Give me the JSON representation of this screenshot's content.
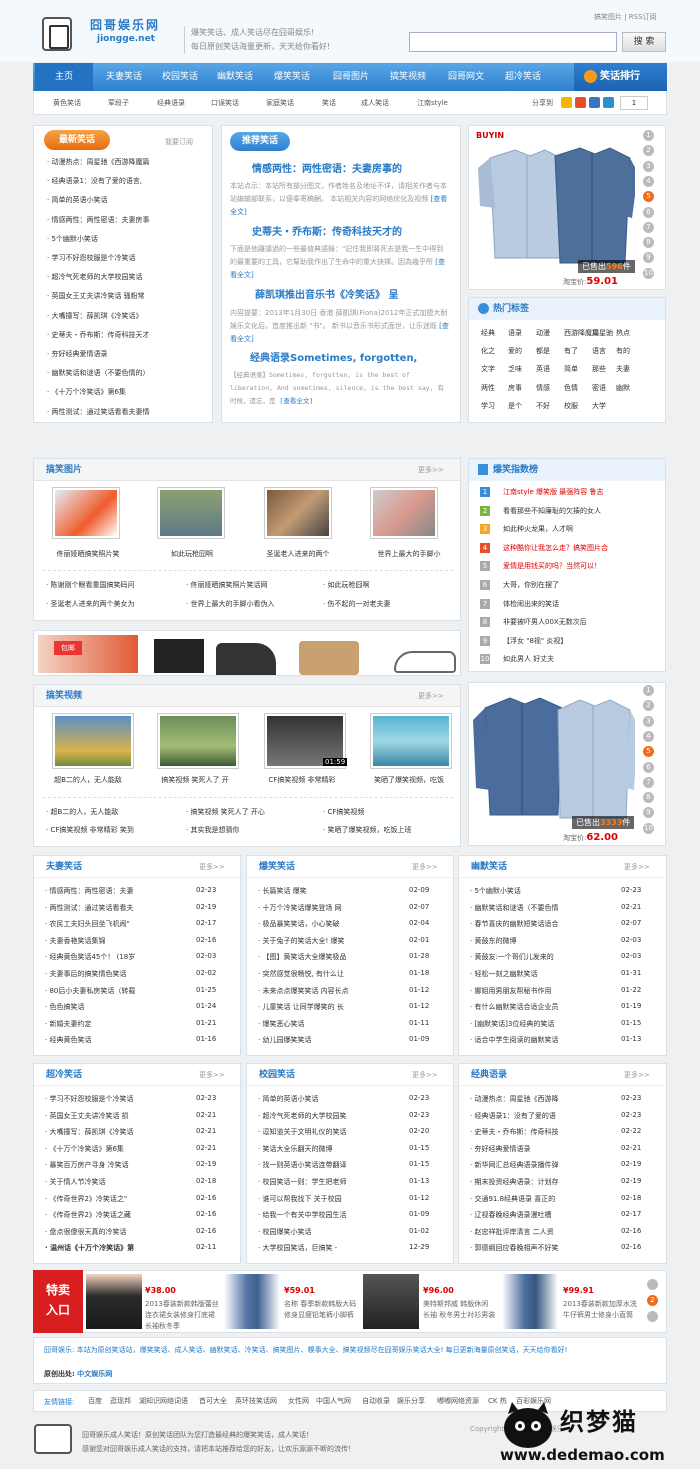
{
  "header": {
    "logo_name": "囧哥娱乐网",
    "logo_domain": "jiongge.net",
    "tagline": [
      "爆笑笑话、成人笑话尽在囧哥娱乐!",
      "每日原创笑话海量更新，天天给你看好!"
    ],
    "top_links": "搞笑图片 | RSS订阅",
    "search_placeholder": "",
    "search_button": "搜 索"
  },
  "nav": {
    "items": [
      "主页",
      "夫妻笑话",
      "校园笑话",
      "幽默笑话",
      "爆笑笑话",
      "囧哥图片",
      "搞笑视频",
      "囧哥网文",
      "超冷笑话"
    ],
    "rank_label": "笑话排行"
  },
  "subnav": {
    "items": [
      "黄色笑话",
      "荤段子",
      "经典语录",
      "口误笑话",
      "家庭笑话",
      "笑话",
      "成人笑话",
      "江南style"
    ],
    "share_label": "分享到",
    "page_num": "1"
  },
  "new_jokes": {
    "title": "最新笑话",
    "subscribe": "我要订阅",
    "items": [
      "动漫热点：周星驰《西游降魔篇",
      "经典语录1：没有了爱的语言,",
      "简单的英语小笑话",
      "情感两性：两性密语：夫妻房事",
      "5个幽默小笑话",
      "学习不好怨校服是个冷笑话",
      "超冷气死老师的大学校园笑话",
      "英国女王丈夫讲冷笑话 骚粉常",
      "大嘴撞写：薛凯琪《冷笑话》",
      "史蒂夫・乔布斯：传奇科技天才",
      "夯好经典爱情语录",
      "幽默笑话和谜语（不要色情的）",
      "《十万个冷笑话》第6集",
      "两性测试：通过笑话看看夫妻情"
    ]
  },
  "recommend": {
    "title": "推荐笑话",
    "articles": [
      {
        "headline": "情感两性：两性密语：夫妻房事的",
        "summary": "本站点示：本站所有部分图文，作者姓名及地址不详，请相关作者与本站编辑部联系，以便奉寄稿酬。 本站相关内容的网络优化及视频",
        "more": "[查看全文]"
      },
      {
        "headline": "史蒂夫・乔布斯：传奇科技天才的",
        "summary": "下面是他離議過的一些最值典語錄：\"記住我即將死去是我一生中得到的最重要的工具，它幫助我作出了生命中的重大抉擇。因為幾乎所",
        "more": "[查看全文]"
      },
      {
        "headline": "薛凯琪推出音乐书《冷笑话》 呈",
        "summary": "内容提要：2013年1月30日 香港 薛凱琪(Fiona)2012年正式加盟大耐娛乐文化后，首度推出新 \"书\"。 新书以音乐书形式面世，让乐迷既",
        "more": "[查看全文]"
      },
      {
        "headline": "经典语录Sometimes, forgotten,",
        "summary": "【经典语录】Sometimes, forgotten, is the best of liberation, And sometimes, silence, is the best say, 有时候，遗忘，是",
        "more": "[查看全文]"
      }
    ]
  },
  "product1": {
    "sold_label": "已售出",
    "sold": "596",
    "sold_unit": "件",
    "price_label": "淘宝价:",
    "price": "59.01",
    "brand": "BUYIN"
  },
  "product2": {
    "sold_label": "已售出",
    "sold": "3333",
    "sold_unit": "件",
    "price_label": "淘宝价:",
    "price": "62.00"
  },
  "slider_pages": [
    "1",
    "2",
    "3",
    "4",
    "5",
    "6",
    "7",
    "8",
    "9",
    "10"
  ],
  "hot_tags": {
    "title": "热门标签",
    "tags": [
      "经典",
      "语录",
      "动漫",
      "西游降魔篇",
      "周星驰",
      "热点",
      "化之",
      "爱的",
      "都是",
      "有了",
      "语言",
      "有的",
      "文字",
      "乏味",
      "英语",
      "简单",
      "那些",
      "夫妻",
      "两性",
      "房事",
      "情感",
      "色情",
      "密语",
      "幽默",
      "学习",
      "是个",
      "不好",
      "校服",
      "大学"
    ]
  },
  "gallery": {
    "title": "搞笑图片",
    "more": "更多>>",
    "thumbs": [
      "佟丽娅晒搞笑照片笑",
      "如此玩枪囧啊",
      "圣诞老人进来的两个",
      "世界上最大的手脚小"
    ],
    "links": [
      "陈谢刚个眼看重国搞笑码问",
      "佟丽娅晒搞笑照片笑话网",
      "如此玩枪囧啊",
      "圣诞老人进来的两个美女为",
      "世界上最大的手脚小看伪入",
      "伤不起的一对老夫妻"
    ]
  },
  "rank": {
    "title": "爆笑指数榜",
    "items": [
      "江南style 爆笑版 最强阵容 鲁志",
      "看看那些不知廉耻的欠揍的女人",
      "如此种火龙果，人才啊",
      "这种酷你让我怎么走？搞笑图片合",
      "爱情是用钱买的吗？当然可以！",
      "大哥，你别在摆了",
      "体检闹出来的笑话",
      "非要被吓男人00X无数次后",
      "【浮女 \"8视\" 炎视】",
      "如此男人 好丈夫"
    ]
  },
  "video": {
    "title": "搞笑视频",
    "more": "更多>>",
    "thumbs": [
      "超B二的人，无人能敌",
      "搞笑视频 笑死人了 开",
      "CF搞笑视频 非常精彩",
      "笑晒了爆笑视频，吃饭"
    ],
    "thumb_badges": [
      "",
      "",
      "01:59",
      ""
    ],
    "links": [
      "超B二的人，无人能敌",
      "搞笑视频 笑死人了 开心",
      "CF搞笑视频",
      "CF搞笑视频 非常精彩 笑到",
      "其实我是想猜你",
      "笑晒了爆笑视频，吃饭上班"
    ]
  },
  "sections": [
    {
      "title": "夫妻笑话",
      "more": "更多>>",
      "items": [
        [
          "情感两性：两性密语：夫妻",
          "02-23"
        ],
        [
          "两性测试：通过笑话看看夫",
          "02-19"
        ],
        [
          "农民工夫妇头回坐飞机闹\"",
          "02-17"
        ],
        [
          "夫妻香艳笑话集锦",
          "02-16"
        ],
        [
          "经典黄色笑话45个！ (18岁",
          "02-03"
        ],
        [
          "夫妻事后的搞笑情色笑话",
          "02-02"
        ],
        [
          "80后小夫妻私房笑话（转载",
          "01-25"
        ],
        [
          "色色搞笑话",
          "01-24"
        ],
        [
          "新婚夫妻约定",
          "01-21"
        ],
        [
          "经典黄色笑话",
          "01-16"
        ]
      ]
    },
    {
      "title": "爆笑笑话",
      "more": "更多>>",
      "items": [
        [
          "长篇笑话 爆笑",
          "02-09"
        ],
        [
          "十万个冷笑话爆笑登场 网",
          "02-07"
        ],
        [
          "极品暴笑笑话，小心笑破",
          "02-04"
        ],
        [
          "关于兔子的笑话大全! 爆笑",
          "02-01"
        ],
        [
          "【图】黄笑话大全爆笑极品",
          "01-28"
        ],
        [
          "突然感觉很畅悦, 有什么让",
          "01-18"
        ],
        [
          "未来点点爆笑笑话 内容长点",
          "01-12"
        ],
        [
          "儿童笑话 让同学爆笑的 长",
          "01-12"
        ],
        [
          "爆笑恶心笑话",
          "01-11"
        ],
        [
          "幼儿园爆笑笑话",
          "01-09"
        ]
      ]
    },
    {
      "title": "幽默笑话",
      "more": "更多>>",
      "items": [
        [
          "5个幽默小笑话",
          "02-23"
        ],
        [
          "幽默笑话和谜语（不要色情",
          "02-21"
        ],
        [
          "春节喜庆的幽默短笑话适合",
          "02-07"
        ],
        [
          "黄鼓东的微博",
          "02-03"
        ],
        [
          "黄鼓友:一个哥们儿发来的",
          "02-03"
        ],
        [
          "轻松一刻之幽默笑话",
          "01-31"
        ],
        [
          "娜姐用男朋友帮秘书作用",
          "01-22"
        ],
        [
          "有什么幽默笑话合适企业员",
          "01-19"
        ],
        [
          "[幽默笑话]3位经典的笑话",
          "01-15"
        ],
        [
          "适合中学生阅读的幽默笑话",
          "01-13"
        ]
      ]
    },
    {
      "title": "超冷笑话",
      "more": "更多>>",
      "items": [
        [
          "学习不好怨校服是个冷笑话",
          "02-23"
        ],
        [
          "英国女王丈夫讲冷笑话 损",
          "02-21"
        ],
        [
          "大嘴撞写：薛凯琪《冷笑话",
          "02-21"
        ],
        [
          "《十万个冷笑话》第6集",
          "02-21"
        ],
        [
          "暴笑百万房产寻身 冷笑话",
          "02-19"
        ],
        [
          "关于情人节冷笑话",
          "02-18"
        ],
        [
          "《传奇世界2》冷笑话之\"",
          "02-16"
        ],
        [
          "《传奇世界2》冷笑话之藏",
          "02-16"
        ],
        [
          "盘点很傻很天真的冷笑话",
          "02-16"
        ],
        [
          "温州话《十万个冷笑话》第",
          "02-11"
        ]
      ]
    },
    {
      "title": "校园笑话",
      "more": "更多>>",
      "items": [
        [
          "简单的英语小笑话",
          "02-23"
        ],
        [
          "超冷气死老师的大学校园笑",
          "02-23"
        ],
        [
          "逗知道关于文明礼仪的笑话",
          "02-20"
        ],
        [
          "笑话大全乐翻天的微博",
          "01-15"
        ],
        [
          "找一则英语小笑话连带翻译",
          "01-15"
        ],
        [
          "校园笑话一则：学生把老师",
          "01-13"
        ],
        [
          "谁可以帮我找下 关于校园",
          "01-12"
        ],
        [
          "给我一个有关中学校园生活",
          "01-09"
        ],
        [
          "校园爆笑小笑话",
          "01-02"
        ],
        [
          "大学校园笑话，巨搞笑 -",
          "12-29"
        ]
      ]
    },
    {
      "title": "经典语录",
      "more": "更多>>",
      "items": [
        [
          "动漫热点：周星驰《西游降",
          "02-23"
        ],
        [
          "经典语录1：没有了爱的语",
          "02-23"
        ],
        [
          "史蒂夫・乔布斯：传奇科技",
          "02-22"
        ],
        [
          "夯好经典爱情语录",
          "02-21"
        ],
        [
          "新华网汇总经典语录播件弹",
          "02-19"
        ],
        [
          "期末投资经典语录：计划存",
          "02-19"
        ],
        [
          "交通91.8经典语录 喜正的",
          "02-18"
        ],
        [
          "辽视春晚经典语录漫吐槽",
          "02-17"
        ],
        [
          "赵忠祥批评岸清言 二人资",
          "02-16"
        ],
        [
          "郭德纲回应春晚相声不好笑",
          "02-16"
        ]
      ]
    }
  ],
  "sale": {
    "title_line1": "特卖",
    "title_line2": "入口",
    "items": [
      {
        "price": "¥38.00",
        "desc": "2013春装新款韩版蕾丝连衣裙女装修身打底裙长袖秋冬季"
      },
      {
        "price": "¥59.01",
        "desc": "名称 春季新款韩版大码修身显瘦铅笔裤小脚裤"
      },
      {
        "price": "¥96.00",
        "desc": "美特斯邦威 韩版休闲 长袖 秋冬男士衬衫男装"
      },
      {
        "price": "¥99.91",
        "desc": "2013春装新款加厚水洗牛仔裤男士修身小直筒"
      }
    ],
    "page": "2"
  },
  "intro": {
    "line1": "囧哥娱乐: 本站为原创笑话站，爆笑笑话、成人笑话、幽默笑话、冷笑话、搞笑图片、糗事大全、搞笑视频尽在囧哥娱乐笑话大全! 每日更新海量原创笑话，天天给你看好!",
    "line2_label": "原创出处:",
    "line2_value": "中文娱乐网"
  },
  "links": {
    "label": "友情链接:",
    "items": [
      "百度",
      "逛现邦",
      "湖知识网络词语",
      "首可大全",
      "英环技笑话网",
      "女性网",
      "中国人气网",
      "自动收录",
      "娱乐分享",
      "嘟嘟网络资源",
      "CK 热",
      "百彩娱乐网"
    ]
  },
  "footer": {
    "line1": "囧哥娱乐成人笑话！原创笑话团队为您打造最经典的爆笑笑话，成人笑话！",
    "line2": "感谢您对囧哥娱乐成人笑话的支持，请把本站推荐给您的好友，让欢乐源源不断的流传！",
    "copyright": "Copyright © 2013 囧哥娱乐"
  },
  "watermark": {
    "text": "织梦猫",
    "site": "www.dedemao.com"
  },
  "colors": {
    "accent": "#2a7bc6",
    "nav": "#3a8ed9",
    "orange": "#f26c1c",
    "red": "#d81e1e"
  }
}
